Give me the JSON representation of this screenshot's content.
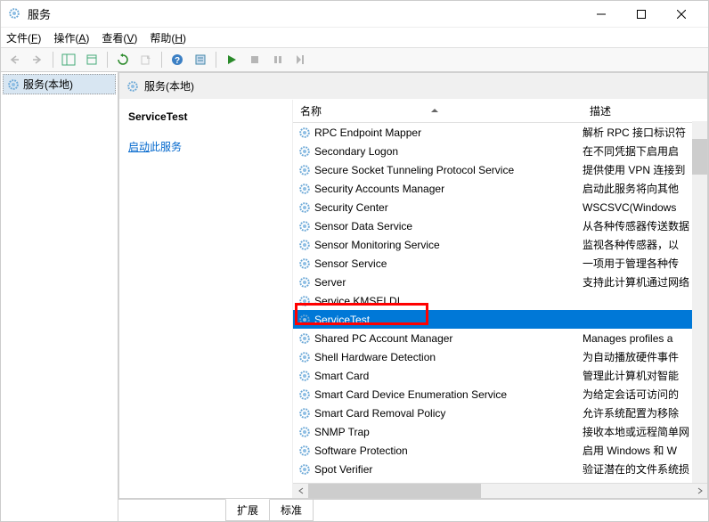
{
  "window": {
    "title": "服务"
  },
  "menus": {
    "file": "文件(F)",
    "action": "操作(A)",
    "view": "查看(V)",
    "help": "帮助(H)"
  },
  "tree": {
    "root": "服务(本地)"
  },
  "inner_header": "服务(本地)",
  "detail": {
    "selected_name": "ServiceTest",
    "action_link": "启动",
    "action_rest": "此服务"
  },
  "columns": {
    "name": "名称",
    "desc": "描述"
  },
  "tabs": {
    "extended": "扩展",
    "standard": "标准"
  },
  "services": [
    {
      "name": "RPC Endpoint Mapper",
      "desc": "解析 RPC 接口标识符",
      "selected": false
    },
    {
      "name": "Secondary Logon",
      "desc": "在不同凭据下启用启",
      "selected": false
    },
    {
      "name": "Secure Socket Tunneling Protocol Service",
      "desc": "提供使用 VPN 连接到",
      "selected": false
    },
    {
      "name": "Security Accounts Manager",
      "desc": "启动此服务将向其他",
      "selected": false
    },
    {
      "name": "Security Center",
      "desc": "WSCSVC(Windows",
      "selected": false
    },
    {
      "name": "Sensor Data Service",
      "desc": "从各种传感器传送数据",
      "selected": false
    },
    {
      "name": "Sensor Monitoring Service",
      "desc": "监视各种传感器，以",
      "selected": false
    },
    {
      "name": "Sensor Service",
      "desc": "一项用于管理各种传",
      "selected": false
    },
    {
      "name": "Server",
      "desc": "支持此计算机通过网络",
      "selected": false
    },
    {
      "name": "Service KMSELDI",
      "desc": "",
      "selected": false
    },
    {
      "name": "ServiceTest",
      "desc": "",
      "selected": true
    },
    {
      "name": "Shared PC Account Manager",
      "desc": "Manages profiles a",
      "selected": false
    },
    {
      "name": "Shell Hardware Detection",
      "desc": "为自动播放硬件事件",
      "selected": false
    },
    {
      "name": "Smart Card",
      "desc": "管理此计算机对智能",
      "selected": false
    },
    {
      "name": "Smart Card Device Enumeration Service",
      "desc": "为给定会话可访问的",
      "selected": false
    },
    {
      "name": "Smart Card Removal Policy",
      "desc": "允许系统配置为移除",
      "selected": false
    },
    {
      "name": "SNMP Trap",
      "desc": "接收本地或远程简单网",
      "selected": false
    },
    {
      "name": "Software Protection",
      "desc": "启用 Windows 和 W",
      "selected": false
    },
    {
      "name": "Spot Verifier",
      "desc": "验证潜在的文件系统损",
      "selected": false
    }
  ]
}
